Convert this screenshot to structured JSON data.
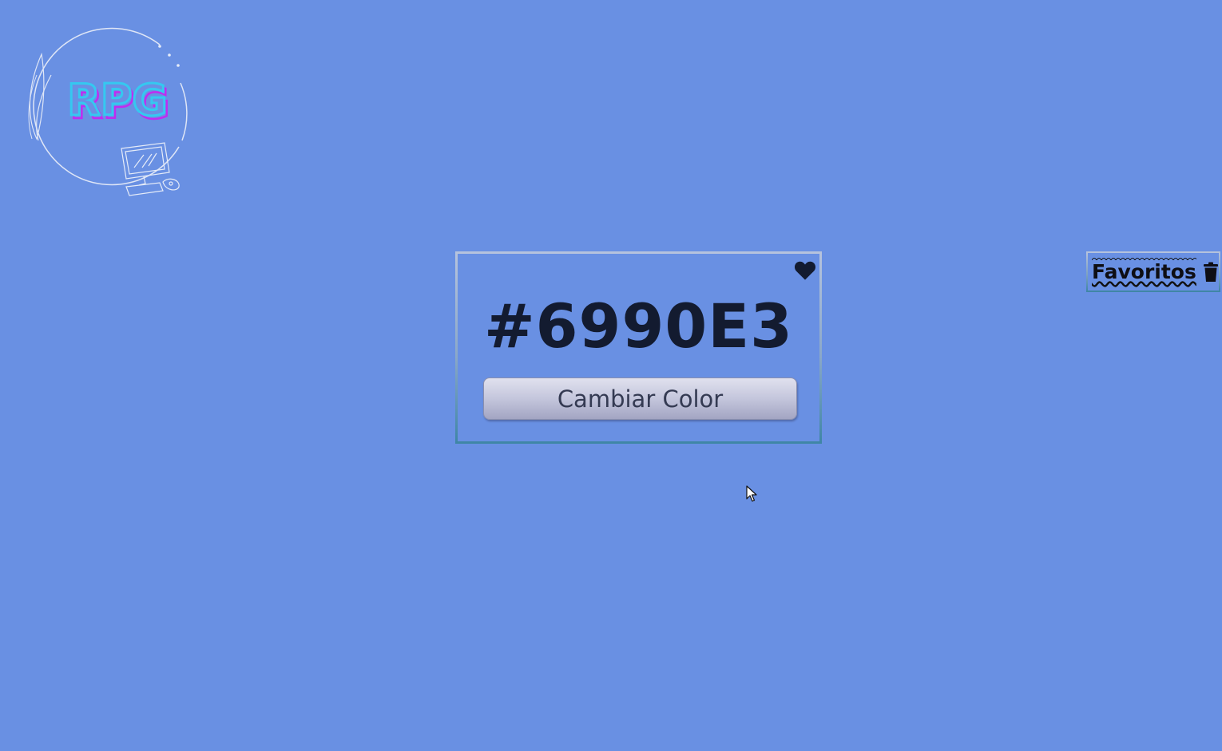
{
  "logo": {
    "text": "RPG"
  },
  "card": {
    "hex_code": "#6990E3",
    "change_button_label": "Cambiar Color",
    "favorite_icon": "heart-icon"
  },
  "favorites": {
    "label": "Favoritos",
    "trash_icon": "trash-icon"
  },
  "colors": {
    "background": "#6990E3",
    "logo_text": "#35c8f0",
    "logo_accent": "#c02cf0",
    "text_dark": "#131b30"
  }
}
